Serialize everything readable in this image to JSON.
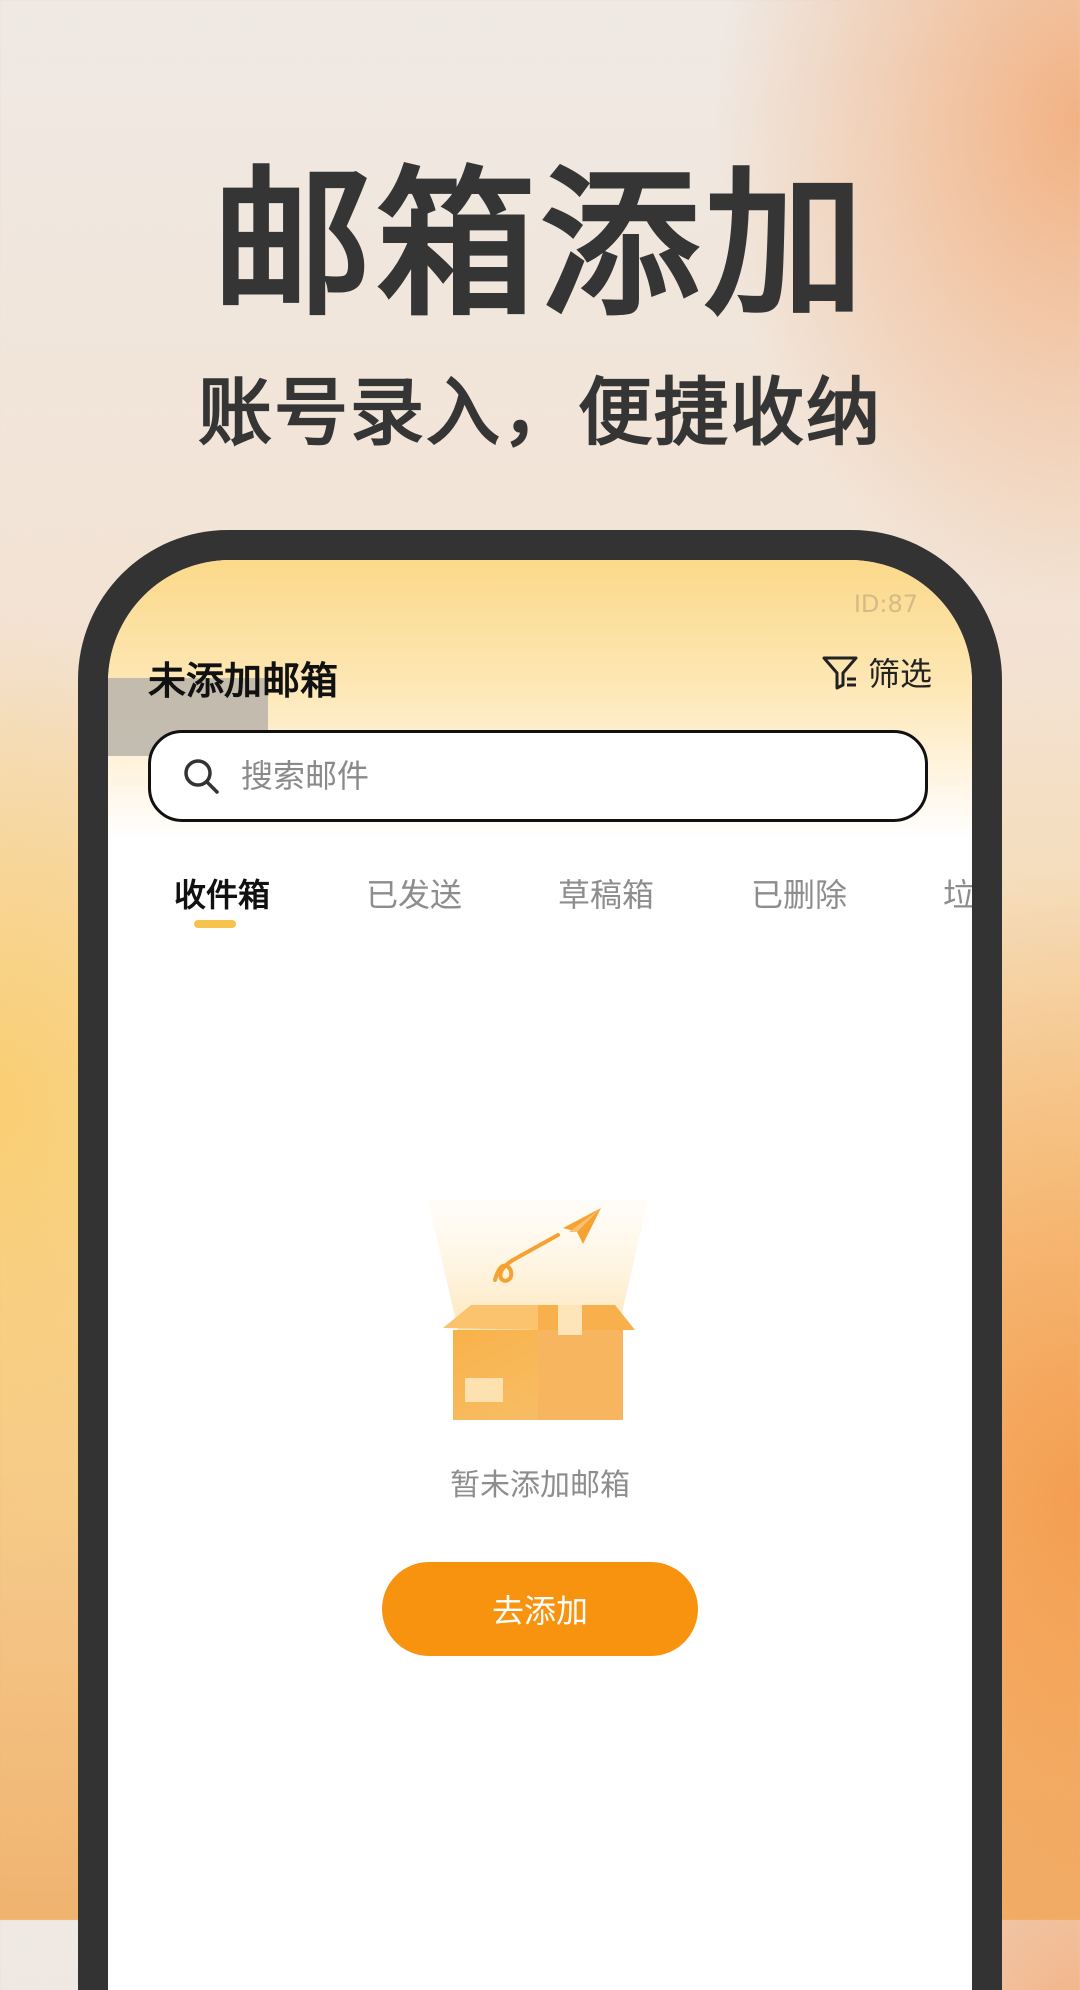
{
  "headline": "邮箱添加",
  "subline": "账号录入，便捷收纳",
  "app": {
    "id_tag": "ID:87",
    "title": "未添加邮箱",
    "filter_label": "筛选",
    "search": {
      "placeholder": "搜索邮件",
      "value": ""
    },
    "tabs": [
      {
        "label": "收件箱",
        "active": true
      },
      {
        "label": "已发送"
      },
      {
        "label": "草稿箱"
      },
      {
        "label": "已删除"
      },
      {
        "label": "垃"
      }
    ],
    "empty_state": {
      "message": "暂未添加邮箱",
      "button_label": "去添加"
    },
    "icons": [
      "filter-icon",
      "search-icon",
      "empty-box-illustration"
    ]
  },
  "colors": {
    "accent": "#f7930f",
    "tab_indicator": "#f7c34c",
    "phone_frame": "#333333",
    "headline_text": "#353535"
  }
}
